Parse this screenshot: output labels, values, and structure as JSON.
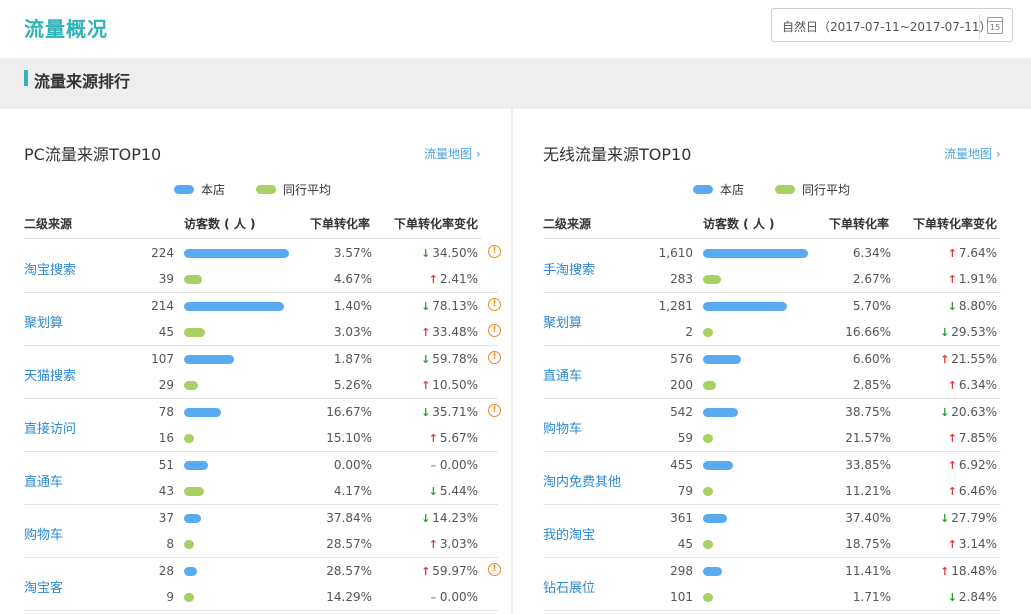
{
  "header": {
    "title": "流量概况",
    "date_range": "自然日（2017-07-11~2017-07-11）",
    "calendar_day": "15"
  },
  "section": {
    "title": "流量来源排行"
  },
  "legend": {
    "self": "本店",
    "peer": "同行平均"
  },
  "colors": {
    "accent": "#2fb3b8",
    "link": "#2d89d3",
    "self_bar": "#5aaaf2",
    "peer_bar": "#a7d162",
    "up": "#e4393c",
    "down": "#2a9d2a",
    "warn": "#ef8a1f"
  },
  "columns": {
    "source": "二级来源",
    "visitors": "访客数 ( 人 )",
    "rate": "下单转化率",
    "change": "下单转化率变化"
  },
  "panels": [
    {
      "title": "PC流量来源TOP10",
      "map_link": "流量地图 ›",
      "bar_max": 224,
      "groups": [
        {
          "label": "淘宝搜索",
          "rows": [
            {
              "visitors": "224",
              "value": 224,
              "rate": "3.57%",
              "dir": "down",
              "change": "34.50%",
              "warn": true
            },
            {
              "visitors": "39",
              "value": 39,
              "rate": "4.67%",
              "dir": "up",
              "change": "2.41%",
              "warn": false
            }
          ]
        },
        {
          "label": "聚划算",
          "rows": [
            {
              "visitors": "214",
              "value": 214,
              "rate": "1.40%",
              "dir": "down",
              "change": "78.13%",
              "warn": true
            },
            {
              "visitors": "45",
              "value": 45,
              "rate": "3.03%",
              "dir": "up",
              "change": "33.48%",
              "warn": true
            }
          ]
        },
        {
          "label": "天猫搜索",
          "rows": [
            {
              "visitors": "107",
              "value": 107,
              "rate": "1.87%",
              "dir": "down",
              "change": "59.78%",
              "warn": true
            },
            {
              "visitors": "29",
              "value": 29,
              "rate": "5.26%",
              "dir": "up",
              "change": "10.50%",
              "warn": false
            }
          ]
        },
        {
          "label": "直接访问",
          "rows": [
            {
              "visitors": "78",
              "value": 78,
              "rate": "16.67%",
              "dir": "down",
              "change": "35.71%",
              "warn": true
            },
            {
              "visitors": "16",
              "value": 16,
              "rate": "15.10%",
              "dir": "up",
              "change": "5.67%",
              "warn": false
            }
          ]
        },
        {
          "label": "直通车",
          "rows": [
            {
              "visitors": "51",
              "value": 51,
              "rate": "0.00%",
              "dir": "flat",
              "change": "0.00%",
              "warn": false
            },
            {
              "visitors": "43",
              "value": 43,
              "rate": "4.17%",
              "dir": "down",
              "change": "5.44%",
              "warn": false
            }
          ]
        },
        {
          "label": "购物车",
          "rows": [
            {
              "visitors": "37",
              "value": 37,
              "rate": "37.84%",
              "dir": "down",
              "change": "14.23%",
              "warn": false
            },
            {
              "visitors": "8",
              "value": 8,
              "rate": "28.57%",
              "dir": "up",
              "change": "3.03%",
              "warn": false
            }
          ]
        },
        {
          "label": "淘宝客",
          "rows": [
            {
              "visitors": "28",
              "value": 28,
              "rate": "28.57%",
              "dir": "up",
              "change": "59.97%",
              "warn": true
            },
            {
              "visitors": "9",
              "value": 9,
              "rate": "14.29%",
              "dir": "flat",
              "change": "0.00%",
              "warn": false
            }
          ]
        }
      ]
    },
    {
      "title": "无线流量来源TOP10",
      "map_link": "流量地图 ›",
      "bar_max": 1610,
      "groups": [
        {
          "label": "手淘搜索",
          "rows": [
            {
              "visitors": "1,610",
              "value": 1610,
              "rate": "6.34%",
              "dir": "up",
              "change": "7.64%",
              "warn": false
            },
            {
              "visitors": "283",
              "value": 283,
              "rate": "2.67%",
              "dir": "up",
              "change": "1.91%",
              "warn": false
            }
          ]
        },
        {
          "label": "聚划算",
          "rows": [
            {
              "visitors": "1,281",
              "value": 1281,
              "rate": "5.70%",
              "dir": "down",
              "change": "8.80%",
              "warn": false
            },
            {
              "visitors": "2",
              "value": 2,
              "rate": "16.66%",
              "dir": "down",
              "change": "29.53%",
              "warn": false
            }
          ]
        },
        {
          "label": "直通车",
          "rows": [
            {
              "visitors": "576",
              "value": 576,
              "rate": "6.60%",
              "dir": "up",
              "change": "21.55%",
              "warn": false
            },
            {
              "visitors": "200",
              "value": 200,
              "rate": "2.85%",
              "dir": "up",
              "change": "6.34%",
              "warn": false
            }
          ]
        },
        {
          "label": "购物车",
          "rows": [
            {
              "visitors": "542",
              "value": 542,
              "rate": "38.75%",
              "dir": "down",
              "change": "20.63%",
              "warn": false
            },
            {
              "visitors": "59",
              "value": 59,
              "rate": "21.57%",
              "dir": "up",
              "change": "7.85%",
              "warn": false
            }
          ]
        },
        {
          "label": "淘内免费其他",
          "rows": [
            {
              "visitors": "455",
              "value": 455,
              "rate": "33.85%",
              "dir": "up",
              "change": "6.92%",
              "warn": false
            },
            {
              "visitors": "79",
              "value": 79,
              "rate": "11.21%",
              "dir": "up",
              "change": "6.46%",
              "warn": false
            }
          ]
        },
        {
          "label": "我的淘宝",
          "rows": [
            {
              "visitors": "361",
              "value": 361,
              "rate": "37.40%",
              "dir": "down",
              "change": "27.79%",
              "warn": false
            },
            {
              "visitors": "45",
              "value": 45,
              "rate": "18.75%",
              "dir": "up",
              "change": "3.14%",
              "warn": false
            }
          ]
        },
        {
          "label": "钻石展位",
          "rows": [
            {
              "visitors": "298",
              "value": 298,
              "rate": "11.41%",
              "dir": "up",
              "change": "18.48%",
              "warn": false
            },
            {
              "visitors": "101",
              "value": 101,
              "rate": "1.71%",
              "dir": "down",
              "change": "2.84%",
              "warn": false
            }
          ]
        }
      ]
    }
  ]
}
